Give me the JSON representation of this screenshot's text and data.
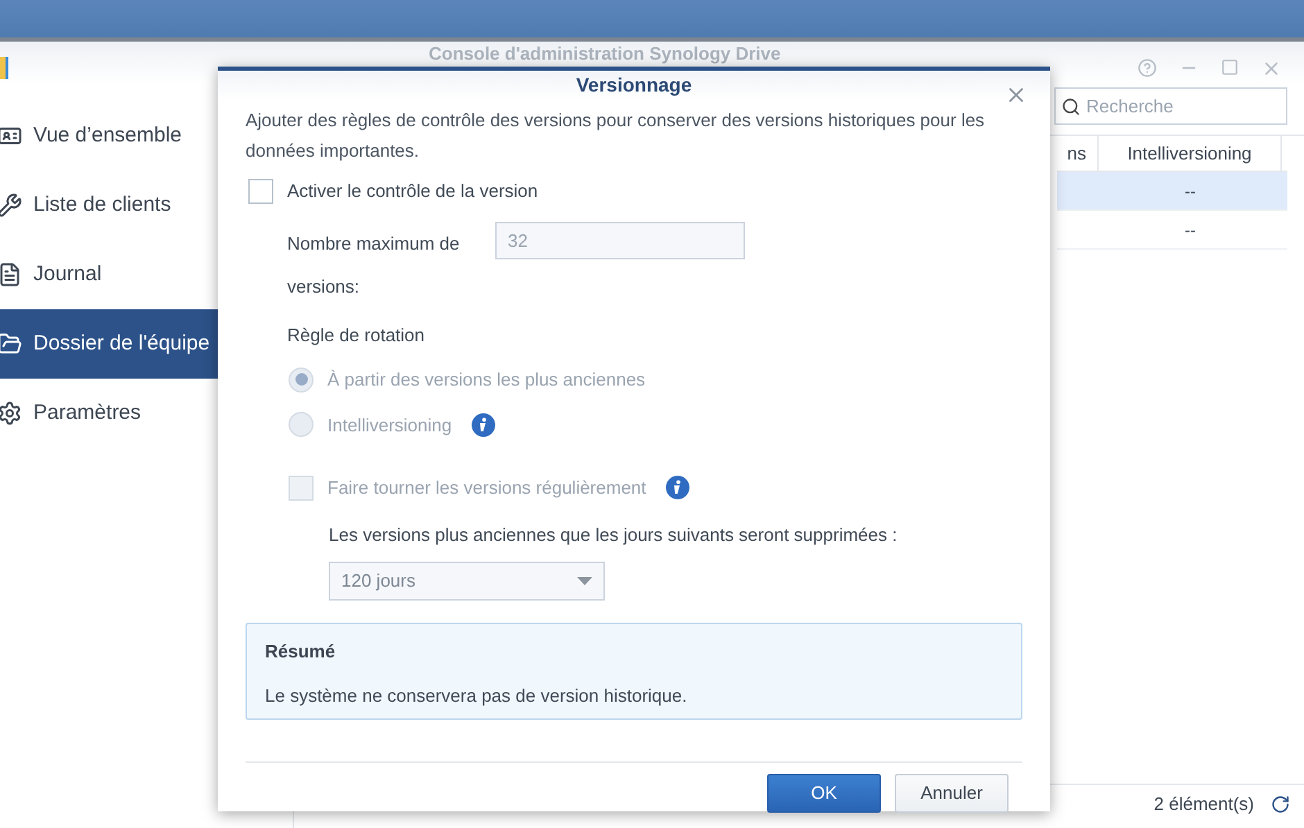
{
  "window": {
    "title": "Console d'administration Synology Drive"
  },
  "sidebar": {
    "items": [
      {
        "label": "Vue d’ensemble",
        "selected": false
      },
      {
        "label": "Liste de clients",
        "selected": false
      },
      {
        "label": "Journal",
        "selected": false
      },
      {
        "label": "Dossier de l'équipe",
        "selected": true
      },
      {
        "label": "Paramètres",
        "selected": false
      }
    ]
  },
  "search": {
    "placeholder": "Recherche"
  },
  "table": {
    "columns": [
      "ns",
      "Intelliversioning"
    ],
    "rows": [
      {
        "cells": [
          "",
          "--"
        ],
        "selected": true
      },
      {
        "cells": [
          "",
          "--"
        ],
        "selected": false
      }
    ]
  },
  "status_bar": {
    "count": "2 élément(s)"
  },
  "dialog": {
    "title": "Versionnage",
    "description": "Ajouter des règles de contrôle des versions pour conserver des versions historiques pour les données importantes.",
    "enable": {
      "label": "Activer le contrôle de la version",
      "checked": false
    },
    "max_versions": {
      "label": "Nombre maximum de versions:",
      "value": "32",
      "disabled": true
    },
    "rotation": {
      "label": "Règle de rotation",
      "options": [
        {
          "label": "À partir des versions les plus anciennes",
          "selected": true,
          "disabled": true,
          "info": false
        },
        {
          "label": "Intelliversioning",
          "selected": false,
          "disabled": true,
          "info": true
        }
      ]
    },
    "periodic": {
      "label": "Faire tourner les versions régulièrement",
      "checked": false,
      "disabled": true
    },
    "delete_note": "Les versions plus anciennes que les jours suivants seront supprimées :",
    "days": {
      "value": "120 jours",
      "disabled": true
    },
    "summary": {
      "title": "Résumé",
      "text": "Le système ne conservera pas de version historique."
    },
    "buttons": [
      {
        "label": "OK",
        "kind": "primary"
      },
      {
        "label": "Annuler",
        "kind": "secondary"
      }
    ]
  }
}
